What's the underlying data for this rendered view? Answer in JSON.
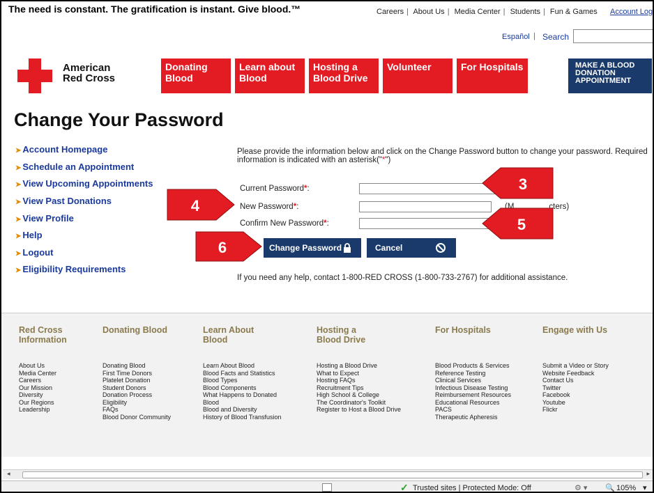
{
  "header": {
    "tagline": "The need is constant. The gratification is instant. Give blood.™",
    "top_links": [
      "Careers",
      "About Us",
      "Media Center",
      "Students",
      "Fun & Games"
    ],
    "account_login": "Account Login",
    "espanol": "Español",
    "search_label": "Search",
    "search_placeholder": ""
  },
  "logo": {
    "line1": "American",
    "line2": "Red Cross"
  },
  "nav": [
    {
      "label_line1": "Donating",
      "label_line2": "Blood"
    },
    {
      "label_line1": "Learn about",
      "label_line2": "Blood"
    },
    {
      "label_line1": "Hosting a",
      "label_line2": "Blood Drive"
    },
    {
      "label_line1": "Volunteer",
      "label_line2": ""
    },
    {
      "label_line1": "For Hospitals",
      "label_line2": ""
    }
  ],
  "make_appointment": [
    "MAKE A BLOOD",
    "DONATION",
    "APPOINTMENT"
  ],
  "page_title": "Change Your Password",
  "left_menu": [
    "Account Homepage",
    "Schedule an Appointment",
    "View Upcoming Appointments",
    "View Past Donations",
    "View Profile",
    "Help",
    "Logout",
    "Eligibility Requirements"
  ],
  "form": {
    "intro_line1": "Please provide the information below and click on the Change Password button to change your password. Required",
    "intro_line2_pre": "information is indicated with an asterisk(\"",
    "intro_ast": "*",
    "intro_line2_post": "\")",
    "current_label": "Current Password",
    "new_label": "New Password",
    "confirm_label": "Confirm New Password",
    "ast": "*",
    "colon": ":",
    "hint_visible": "(M",
    "hint_tail": "cters)",
    "change_button": "Change Password",
    "cancel_button": "Cancel",
    "help_text": "If you need any help, contact 1-800-RED CROSS (1-800-733-2767) for additional assistance."
  },
  "callouts": [
    "3",
    "4",
    "5",
    "6"
  ],
  "footer": {
    "columns": [
      {
        "heading": [
          "Red Cross",
          "Information"
        ],
        "links": [
          "About Us",
          "Media Center",
          "Careers",
          "Our Mission",
          "Diversity",
          "Our Regions",
          "Leadership"
        ]
      },
      {
        "heading": [
          "Donating Blood",
          ""
        ],
        "links": [
          "Donating Blood",
          "First Time Donors",
          "Platelet Donation",
          "Student Donors",
          "Donation Process",
          "Eligibility",
          "FAQs",
          "Blood Donor Community"
        ]
      },
      {
        "heading": [
          "Learn About",
          "Blood"
        ],
        "links": [
          "Learn About Blood",
          "Blood Facts and Statistics",
          "Blood Types",
          "Blood Components",
          "What Happens to Donated",
          "Blood",
          "Blood and Diversity",
          "History of Blood Transfusion"
        ]
      },
      {
        "heading": [
          "Hosting a",
          "Blood Drive"
        ],
        "links": [
          "Hosting a Blood Drive",
          "What to Expect",
          "Hosting FAQs",
          "Recruitment Tips",
          "High School & College",
          "The Coordinator's Toolkit",
          "Register to Host a Blood Drive"
        ]
      },
      {
        "heading": [
          "For Hospitals",
          ""
        ],
        "links": [
          "Blood Products & Services",
          "Reference Testing",
          "Clinical Services",
          "Infectious Disease Testing",
          "Reimbursement Resources",
          "Educational Resources",
          "PACS",
          "Therapeutic Apheresis"
        ]
      },
      {
        "heading": [
          "Engage with Us",
          ""
        ],
        "links": [
          "Submit a Video or Story",
          "Website Feedback",
          "Contact Us",
          "Twitter",
          "Facebook",
          "Youtube",
          "Flickr"
        ]
      }
    ]
  },
  "statusbar": {
    "zone": "Trusted sites | Protected Mode: Off",
    "zoom": "105%"
  },
  "colors": {
    "red": "#e31b23",
    "navy": "#1a3a6b",
    "link": "#1a3a9c",
    "footer_heading": "#8a7a4e"
  }
}
